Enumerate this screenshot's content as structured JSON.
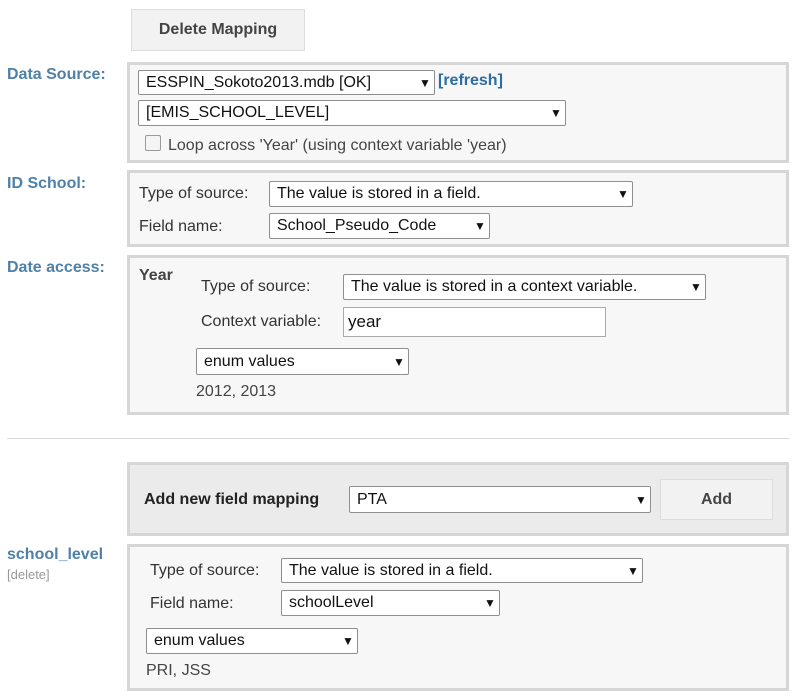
{
  "top": {
    "delete_mapping_label": "Delete Mapping"
  },
  "data_source": {
    "label": "Data Source:",
    "db_select": "ESSPIN_Sokoto2013.mdb [OK]",
    "refresh_link": "[refresh]",
    "table_select": "[EMIS_SCHOOL_LEVEL]",
    "loop_checkbox_label": "Loop across 'Year' (using context variable 'year)"
  },
  "id_school": {
    "label": "ID School:",
    "type_label": "Type of source:",
    "type_select": "The value is stored in a field.",
    "field_label": "Field name:",
    "field_select": "School_Pseudo_Code"
  },
  "date_access": {
    "label": "Date access:",
    "section_title": "Year",
    "type_label": "Type of source:",
    "type_select": "The value is stored in a context variable.",
    "context_label": "Context variable:",
    "context_value": "year",
    "enum_select": "enum values",
    "enum_values": "2012, 2013"
  },
  "add_mapping": {
    "label": "Add new field mapping",
    "field_select": "PTA",
    "add_button": "Add"
  },
  "school_level": {
    "label": "school_level",
    "delete_link": "[delete]",
    "type_label": "Type of source:",
    "type_select": "The value is stored in a field.",
    "field_label": "Field name:",
    "field_select": "schoolLevel",
    "enum_select": "enum values",
    "enum_values": "PRI, JSS"
  }
}
